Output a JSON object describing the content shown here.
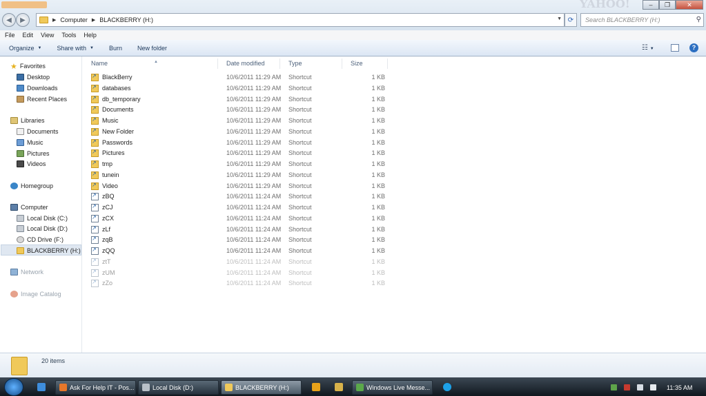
{
  "address": {
    "crumbs": [
      "Computer",
      "BLACKBERRY (H:)"
    ]
  },
  "search": {
    "placeholder": "Search BLACKBERRY (H:)"
  },
  "menu": [
    "File",
    "Edit",
    "View",
    "Tools",
    "Help"
  ],
  "commands": {
    "organize": "Organize",
    "share_with": "Share with",
    "burn": "Burn",
    "new_folder": "New folder"
  },
  "nav": {
    "favorites": "Favorites",
    "desktop": "Desktop",
    "downloads": "Downloads",
    "recent": "Recent Places",
    "libraries": "Libraries",
    "documents": "Documents",
    "music": "Music",
    "pictures": "Pictures",
    "videos": "Videos",
    "homegroup": "Homegroup",
    "computer": "Computer",
    "local_c": "Local Disk (C:)",
    "local_d": "Local Disk (D:)",
    "cd_drive": "CD Drive (F:)",
    "blackberry": "BLACKBERRY (H:)",
    "network": "Network",
    "image_catalog": "Image Catalog"
  },
  "columns": {
    "name": "Name",
    "date": "Date modified",
    "type": "Type",
    "size": "Size"
  },
  "files": [
    {
      "name": "BlackBerry",
      "date": "10/6/2011 11:29 AM",
      "type": "Shortcut",
      "size": "1 KB"
    },
    {
      "name": "databases",
      "date": "10/6/2011 11:29 AM",
      "type": "Shortcut",
      "size": "1 KB"
    },
    {
      "name": "db_temporary",
      "date": "10/6/2011 11:29 AM",
      "type": "Shortcut",
      "size": "1 KB"
    },
    {
      "name": "Documents",
      "date": "10/6/2011 11:29 AM",
      "type": "Shortcut",
      "size": "1 KB"
    },
    {
      "name": "Music",
      "date": "10/6/2011 11:29 AM",
      "type": "Shortcut",
      "size": "1 KB"
    },
    {
      "name": "New Folder",
      "date": "10/6/2011 11:29 AM",
      "type": "Shortcut",
      "size": "1 KB"
    },
    {
      "name": "Passwords",
      "date": "10/6/2011 11:29 AM",
      "type": "Shortcut",
      "size": "1 KB"
    },
    {
      "name": "Pictures",
      "date": "10/6/2011 11:29 AM",
      "type": "Shortcut",
      "size": "1 KB"
    },
    {
      "name": "tmp",
      "date": "10/6/2011 11:29 AM",
      "type": "Shortcut",
      "size": "1 KB"
    },
    {
      "name": "tunein",
      "date": "10/6/2011 11:29 AM",
      "type": "Shortcut",
      "size": "1 KB"
    },
    {
      "name": "Video",
      "date": "10/6/2011 11:29 AM",
      "type": "Shortcut",
      "size": "1 KB"
    },
    {
      "name": "zBQ",
      "date": "10/6/2011 11:24 AM",
      "type": "Shortcut",
      "size": "1 KB"
    },
    {
      "name": "zCJ",
      "date": "10/6/2011 11:24 AM",
      "type": "Shortcut",
      "size": "1 KB"
    },
    {
      "name": "zCX",
      "date": "10/6/2011 11:24 AM",
      "type": "Shortcut",
      "size": "1 KB"
    },
    {
      "name": "zLf",
      "date": "10/6/2011 11:24 AM",
      "type": "Shortcut",
      "size": "1 KB"
    },
    {
      "name": "zqB",
      "date": "10/6/2011 11:24 AM",
      "type": "Shortcut",
      "size": "1 KB"
    },
    {
      "name": "zQQ",
      "date": "10/6/2011 11:24 AM",
      "type": "Shortcut",
      "size": "1 KB"
    },
    {
      "name": "ztT",
      "date": "10/6/2011 11:24 AM",
      "type": "Shortcut",
      "size": "1 KB"
    },
    {
      "name": "zUM",
      "date": "10/6/2011 11:24 AM",
      "type": "Shortcut",
      "size": "1 KB"
    },
    {
      "name": "zZo",
      "date": "10/6/2011 11:24 AM",
      "type": "Shortcut",
      "size": "1 KB"
    }
  ],
  "details": {
    "item_count": "20 items"
  },
  "taskbar": {
    "tasks": [
      "Ask For Help IT - Pos...",
      "Local Disk (D:)",
      "BLACKBERRY (H:)",
      "Windows Live Messe..."
    ],
    "clock": "11:35 AM"
  },
  "colors": {
    "accent": "#2c6fc1",
    "folder": "#f0c95a",
    "taskbar": "#10171e"
  }
}
